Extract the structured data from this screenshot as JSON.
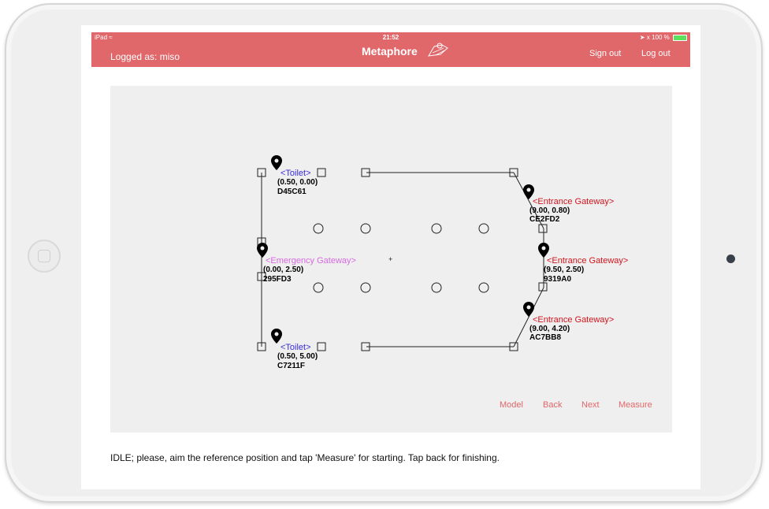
{
  "status_bar": {
    "device": "iPad",
    "time": "21:52",
    "battery": "100 %"
  },
  "header": {
    "logged_as": "Logged as: miso",
    "title": "Metaphore",
    "sign_out": "Sign out",
    "log_out": "Log out"
  },
  "map": {
    "pins": [
      {
        "name": "<Toilet>",
        "coords": "(0.50, 0.00)",
        "id": "D45C61",
        "color": "#3a2bd6"
      },
      {
        "name": "<Entrance Gateway>",
        "coords": "(9.00, 0.80)",
        "id": "CE2FD2",
        "color": "#d0141c"
      },
      {
        "name": "<Emergency Gateway>",
        "coords": "(0.00, 2.50)",
        "id": "295FD3",
        "color": "#d66ae0"
      },
      {
        "name": "<Entrance Gateway>",
        "coords": "(9.50, 2.50)",
        "id": "9319A0",
        "color": "#d0141c"
      },
      {
        "name": "<Entrance Gateway>",
        "coords": "(9.00, 4.20)",
        "id": "AC7BB8",
        "color": "#d0141c"
      },
      {
        "name": "<Toilet>",
        "coords": "(0.50, 5.00)",
        "id": "C7211F",
        "color": "#3a2bd6"
      }
    ]
  },
  "buttons": {
    "model": "Model",
    "back": "Back",
    "next": "Next",
    "measure": "Measure"
  },
  "status_message": "IDLE; please, aim the reference position and tap 'Measure' for starting. Tap back for finishing.",
  "colors": {
    "accent": "#e0676a",
    "canvas": "#efefef"
  }
}
